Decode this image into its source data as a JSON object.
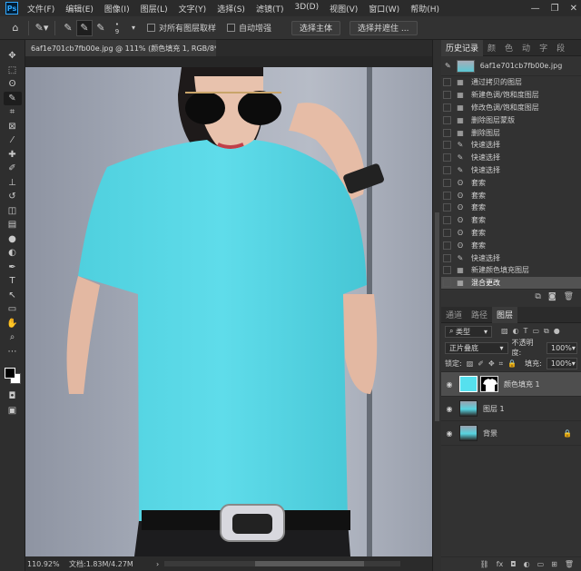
{
  "menubar": {
    "logo": "Ps",
    "items": [
      "文件(F)",
      "编辑(E)",
      "图像(I)",
      "图层(L)",
      "文字(Y)",
      "选择(S)",
      "滤镜(T)",
      "3D(D)",
      "视图(V)",
      "窗口(W)",
      "帮助(H)"
    ],
    "window_controls": {
      "minimize": "—",
      "restore": "❐",
      "close": "✕"
    }
  },
  "options": {
    "home_icon": "⌂",
    "brush_size": "9",
    "sample_all_layers": "对所有图层取样",
    "auto_enhance": "自动增强",
    "select_subject": "选择主体",
    "select_and_mask": "选择并遮住 ..."
  },
  "tools": [
    {
      "name": "move-tool",
      "glyph": "✥"
    },
    {
      "name": "marquee-tool",
      "glyph": "⬚"
    },
    {
      "name": "lasso-tool",
      "glyph": "ʘ"
    },
    {
      "name": "quick-selection-tool",
      "glyph": "✎",
      "active": true
    },
    {
      "name": "crop-tool",
      "glyph": "⌗"
    },
    {
      "name": "frame-tool",
      "glyph": "⊠"
    },
    {
      "name": "eyedropper-tool",
      "glyph": "⁄"
    },
    {
      "name": "spot-healing-tool",
      "glyph": "✚"
    },
    {
      "name": "brush-tool",
      "glyph": "✐"
    },
    {
      "name": "clone-stamp-tool",
      "glyph": "⊥"
    },
    {
      "name": "history-brush-tool",
      "glyph": "↺"
    },
    {
      "name": "eraser-tool",
      "glyph": "◫"
    },
    {
      "name": "gradient-tool",
      "glyph": "▤"
    },
    {
      "name": "blur-tool",
      "glyph": "●"
    },
    {
      "name": "dodge-tool",
      "glyph": "◐"
    },
    {
      "name": "pen-tool",
      "glyph": "✒"
    },
    {
      "name": "type-tool",
      "glyph": "T"
    },
    {
      "name": "path-selection-tool",
      "glyph": "↖"
    },
    {
      "name": "rectangle-tool",
      "glyph": "▭"
    },
    {
      "name": "hand-tool",
      "glyph": "✋"
    },
    {
      "name": "zoom-tool",
      "glyph": "⌕"
    },
    {
      "name": "more-tools",
      "glyph": "⋯"
    }
  ],
  "document": {
    "tab_title": "6af1e701cb7fb00e.jpg @ 111% (颜色填充 1, RGB/8*) *",
    "zoom": "110.92%",
    "doc_info": "文档:1.83M/4.27M",
    "tab_close": "×"
  },
  "history_panel": {
    "tabs": [
      "历史记录",
      "颜",
      "色",
      "动",
      "字",
      "段"
    ],
    "snapshot_name": "6af1e701cb7fb00e.jpg",
    "items": [
      {
        "icon": "▦",
        "label": "通过拷贝的图层"
      },
      {
        "icon": "▦",
        "label": "新建色调/饱和度图层"
      },
      {
        "icon": "▦",
        "label": "修改色调/饱和度图层"
      },
      {
        "icon": "▦",
        "label": "删除图层蒙版"
      },
      {
        "icon": "▦",
        "label": "删除图层"
      },
      {
        "icon": "✎",
        "label": "快速选择"
      },
      {
        "icon": "✎",
        "label": "快速选择"
      },
      {
        "icon": "✎",
        "label": "快速选择"
      },
      {
        "icon": "ʘ",
        "label": "套索"
      },
      {
        "icon": "ʘ",
        "label": "套索"
      },
      {
        "icon": "ʘ",
        "label": "套索"
      },
      {
        "icon": "ʘ",
        "label": "套索"
      },
      {
        "icon": "ʘ",
        "label": "套索"
      },
      {
        "icon": "ʘ",
        "label": "套索"
      },
      {
        "icon": "✎",
        "label": "快速选择"
      },
      {
        "icon": "▦",
        "label": "新建颜色填充图层"
      },
      {
        "icon": "▦",
        "label": "混合更改",
        "selected": true
      }
    ]
  },
  "layers_panel": {
    "tabs": [
      "通道",
      "路径",
      "图层"
    ],
    "filter_label": "类型",
    "blend_mode": "正片叠底",
    "opacity_label": "不透明度:",
    "opacity_value": "100%",
    "lock_label": "锁定:",
    "fill_label": "填充:",
    "fill_value": "100%",
    "layers": [
      {
        "name": "颜色填充 1",
        "type": "fill",
        "selected": true
      },
      {
        "name": "图层 1",
        "type": "photo"
      },
      {
        "name": "背景",
        "type": "photo",
        "locked": true
      }
    ]
  },
  "colors": {
    "shirt": "#56d8e6",
    "wall": "#a4aab7",
    "selection": "#525252"
  }
}
